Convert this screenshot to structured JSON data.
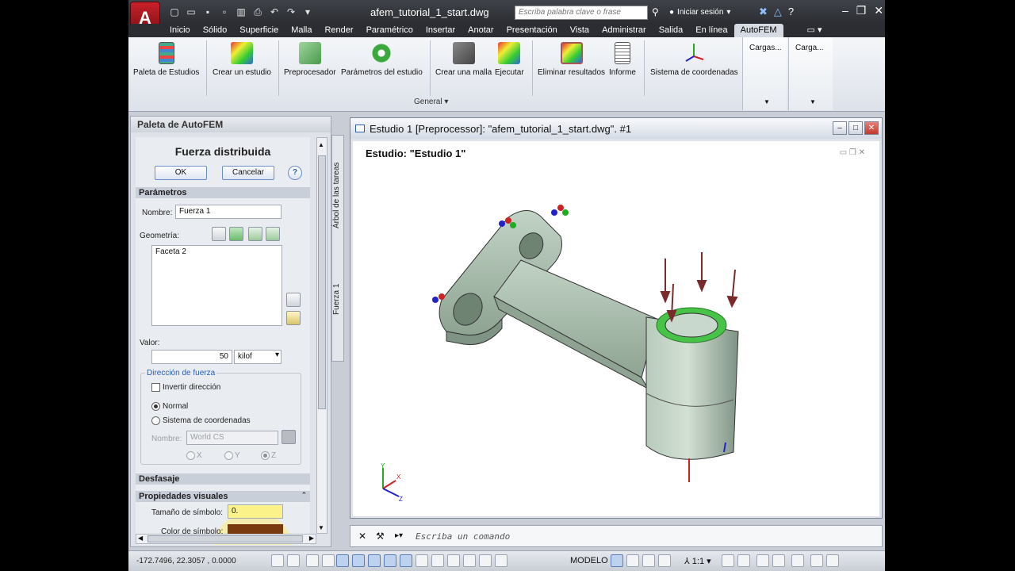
{
  "titlebar": {
    "app_menu_glyph": "A",
    "document_title": "afem_tutorial_1_start.dwg",
    "search_placeholder": "Escriba palabra clave o frase",
    "signin_label": "Iniciar sesión"
  },
  "ribbon_tabs": [
    "Inicio",
    "Sólido",
    "Superficie",
    "Malla",
    "Render",
    "Paramétrico",
    "Insertar",
    "Anotar",
    "Presentación",
    "Vista",
    "Administrar",
    "Salida",
    "En línea",
    "AutoFEM"
  ],
  "active_tab": "AutoFEM",
  "ribbon": {
    "buttons": [
      {
        "label": "Paleta de Estudios",
        "icon": "palette-icon"
      },
      {
        "label": "Crear un estudio",
        "icon": "study-cube-icon"
      },
      {
        "label": "Preprocesador",
        "icon": "green-cube-icon"
      },
      {
        "label": "Parámetros del estudio",
        "icon": "gear-icon"
      },
      {
        "label": "Crear una malla",
        "icon": "mesh-cube-icon"
      },
      {
        "label": "Ejecutar",
        "icon": "run-cube-icon"
      },
      {
        "label": "Eliminar resultados",
        "icon": "clear-results-icon"
      },
      {
        "label": "Informe",
        "icon": "report-icon"
      },
      {
        "label": "Sistema de coordenadas",
        "icon": "coordinate-system-icon"
      }
    ],
    "group_label": "General",
    "cargas_1": "Cargas...",
    "cargas_2": "Carga..."
  },
  "palette": {
    "header": "Paleta de AutoFEM",
    "form_title": "Fuerza distribuida",
    "ok_label": "OK",
    "cancel_label": "Cancelar",
    "section_params": "Parámetros",
    "name_label": "Nombre:",
    "name_value": "Fuerza 1",
    "geometry_label": "Geometría:",
    "geometry_items": [
      "Faceta 2"
    ],
    "value_label": "Valor:",
    "value": "50",
    "unit": "kilof",
    "direction_group": "Dirección de fuerza",
    "invert_label": "Invertir dirección",
    "normal_label": "Normal",
    "coord_sys_label": "Sistema de coordenadas",
    "cs_name_label": "Nombre:",
    "cs_name_value": "World CS",
    "axis_x": "X",
    "axis_y": "Y",
    "axis_z": "Z",
    "section_offset": "Desfasaje",
    "section_visual": "Propiedades visuales",
    "symbol_size_label": "Tamaño de símbolo:",
    "symbol_size_value": "0.",
    "symbol_color_label": "Color de símbolo:",
    "side_tab_tree": "Árbol de las tareas",
    "side_tab_force": "Fuerza 1"
  },
  "viewport": {
    "title": "Estudio 1 [Preprocessor]: \"afem_tutorial_1_start.dwg\". #1",
    "study_label": "Estudio: \"Estudio 1\"",
    "axis_x": "X",
    "axis_y": "Y",
    "axis_z": "Z"
  },
  "command": {
    "placeholder": "Escriba un comando"
  },
  "status": {
    "coords": "-172.7496, 22.3057 , 0.0000",
    "model_label": "MODELO",
    "scale": "1:1"
  },
  "colors": {
    "accent": "#3d6fb5",
    "part_fill": "#a9bfb0",
    "face_highlight": "#3ec43e",
    "force_arrow": "#7a2a2a"
  }
}
